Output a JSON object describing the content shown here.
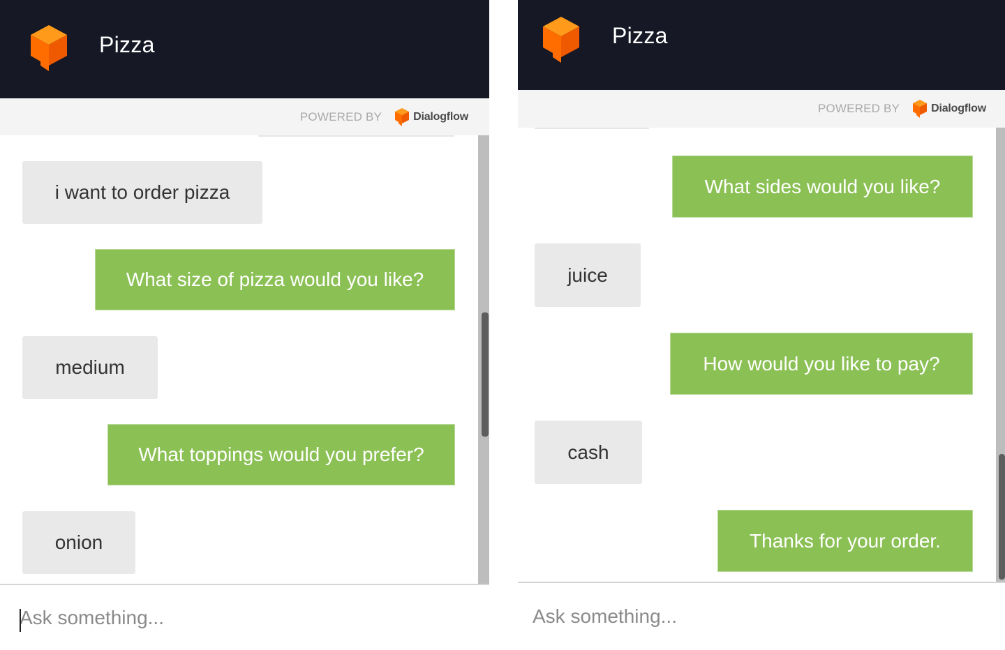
{
  "panels": [
    {
      "header": {
        "title": "Pizza",
        "logo_icon": "dialogflow-cube-icon"
      },
      "powered_by": {
        "label": "POWERED BY",
        "brand": "Dialogflow"
      },
      "messages": [
        {
          "from": "user",
          "text": "i want to order pizza"
        },
        {
          "from": "bot",
          "text": "What size of pizza would you like?"
        },
        {
          "from": "user",
          "text": "medium"
        },
        {
          "from": "bot",
          "text": "What toppings would you prefer?"
        },
        {
          "from": "user",
          "text": "onion"
        }
      ],
      "input": {
        "placeholder": "Ask something..."
      }
    },
    {
      "header": {
        "title": "Pizza",
        "logo_icon": "dialogflow-cube-icon"
      },
      "powered_by": {
        "label": "POWERED BY",
        "brand": "Dialogflow"
      },
      "messages": [
        {
          "from": "bot",
          "text": "What sides would you like?"
        },
        {
          "from": "user",
          "text": "juice"
        },
        {
          "from": "bot",
          "text": "How would you like to pay?"
        },
        {
          "from": "user",
          "text": "cash"
        },
        {
          "from": "bot",
          "text": "Thanks for your order."
        }
      ],
      "input": {
        "placeholder": "Ask something..."
      }
    }
  ],
  "colors": {
    "header_bg": "#161825",
    "bot_bubble": "#8bc055",
    "user_bubble": "#e9e9e9",
    "brand_orange": "#ff6d00"
  }
}
